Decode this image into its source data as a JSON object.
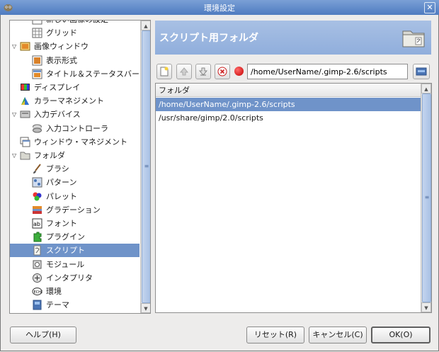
{
  "window": {
    "title": "環境設定"
  },
  "tree": {
    "items": [
      {
        "label": "新しい画像の設定",
        "level": 1,
        "icon": "image-template-icon"
      },
      {
        "label": "グリッド",
        "level": 1,
        "icon": "grid-icon"
      },
      {
        "label": "画像ウィンドウ",
        "level": 0,
        "icon": "image-window-icon",
        "expanded": true
      },
      {
        "label": "表示形式",
        "level": 1,
        "icon": "appearance-icon"
      },
      {
        "label": "タイトル＆ステータスバー",
        "level": 1,
        "icon": "title-status-icon"
      },
      {
        "label": "ディスプレイ",
        "level": 0,
        "icon": "display-icon"
      },
      {
        "label": "カラーマネジメント",
        "level": 0,
        "icon": "color-management-icon"
      },
      {
        "label": "入力デバイス",
        "level": 0,
        "icon": "input-devices-icon",
        "expanded": true
      },
      {
        "label": "入力コントローラ",
        "level": 1,
        "icon": "input-controllers-icon"
      },
      {
        "label": "ウィンドウ・マネジメント",
        "level": 0,
        "icon": "window-management-icon"
      },
      {
        "label": "フォルダ",
        "level": 0,
        "icon": "folders-icon",
        "expanded": true
      },
      {
        "label": "ブラシ",
        "level": 1,
        "icon": "brush-icon"
      },
      {
        "label": "パターン",
        "level": 1,
        "icon": "pattern-icon"
      },
      {
        "label": "パレット",
        "level": 1,
        "icon": "palette-icon"
      },
      {
        "label": "グラデーション",
        "level": 1,
        "icon": "gradient-icon"
      },
      {
        "label": "フォント",
        "level": 1,
        "icon": "font-icon"
      },
      {
        "label": "プラグイン",
        "level": 1,
        "icon": "plugin-icon"
      },
      {
        "label": "スクリプト",
        "level": 1,
        "icon": "script-icon",
        "selected": true
      },
      {
        "label": "モジュール",
        "level": 1,
        "icon": "module-icon"
      },
      {
        "label": "インタプリタ",
        "level": 1,
        "icon": "interpreter-icon"
      },
      {
        "label": "環境",
        "level": 1,
        "icon": "environment-icon"
      },
      {
        "label": "テーマ",
        "level": 1,
        "icon": "theme-icon"
      }
    ]
  },
  "page": {
    "title": "スクリプト用フォルダ"
  },
  "path_input": {
    "value": "/home/UserName/.gimp-2.6/scripts"
  },
  "list": {
    "column_header": "フォルダ",
    "rows": [
      {
        "path": "/home/UserName/.gimp-2.6/scripts",
        "selected": true
      },
      {
        "path": "/usr/share/gimp/2.0/scripts",
        "selected": false
      }
    ]
  },
  "buttons": {
    "help": "ヘルプ(H)",
    "reset": "リセット(R)",
    "cancel": "キャンセル(C)",
    "ok": "OK(O)"
  },
  "colors": {
    "selection": "#6f93c9",
    "header_bg": "#9db8e1",
    "titlebar": "#5a86c8"
  }
}
